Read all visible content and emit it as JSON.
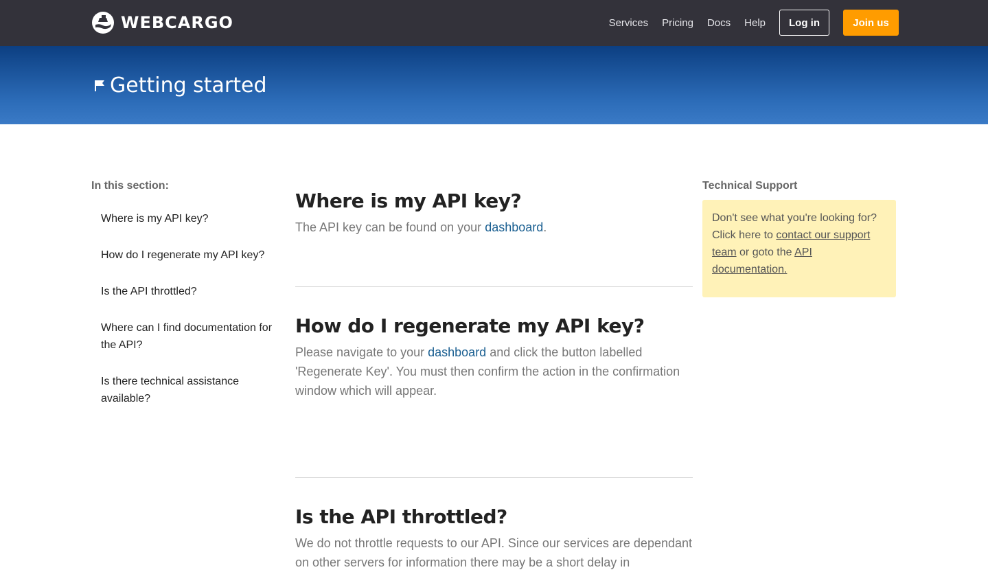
{
  "brand": {
    "name": "WEBCARGO",
    "logo_icon": "cargo-logo-icon"
  },
  "nav": {
    "links": [
      "Services",
      "Pricing",
      "Docs",
      "Help"
    ],
    "login_label": "Log in",
    "join_label": "Join us"
  },
  "hero": {
    "icon": "flag-icon",
    "title": "Getting started"
  },
  "section_nav": {
    "heading": "In this section:",
    "items": [
      "Where is my API key?",
      "How do I regenerate my API key?",
      "Is the API throttled?",
      "Where can I find documentation for the API?",
      "Is there technical assistance available?"
    ]
  },
  "faqs": [
    {
      "question": "Where is my API key?",
      "answer_before": "The API key can be found on your ",
      "link": "dashboard",
      "answer_after": "."
    },
    {
      "question": "How do I regenerate my API key?",
      "answer_before": "Please navigate to your ",
      "link": "dashboard",
      "answer_after": " and click the button labelled 'Regenerate Key'. You must then confirm the action in the confirmation window which will appear."
    },
    {
      "question": "Is the API throttled?",
      "answer": "We do not throttle requests to our API. Since our services are dependant on other servers for information there may be a short delay in"
    }
  ],
  "support": {
    "heading": "Technical Support",
    "text_1": "Don't see what you're looking for? Click here to ",
    "link_1": "contact our support team",
    "text_2": " or goto the ",
    "link_2": "API documentation."
  },
  "colors": {
    "topbar": "#33323a",
    "hero_top": "#0c3f82",
    "hero_bottom": "#3a7ac6",
    "join_button": "#ff9c00",
    "link": "#1a5f91",
    "support_box": "#fff2b8"
  }
}
